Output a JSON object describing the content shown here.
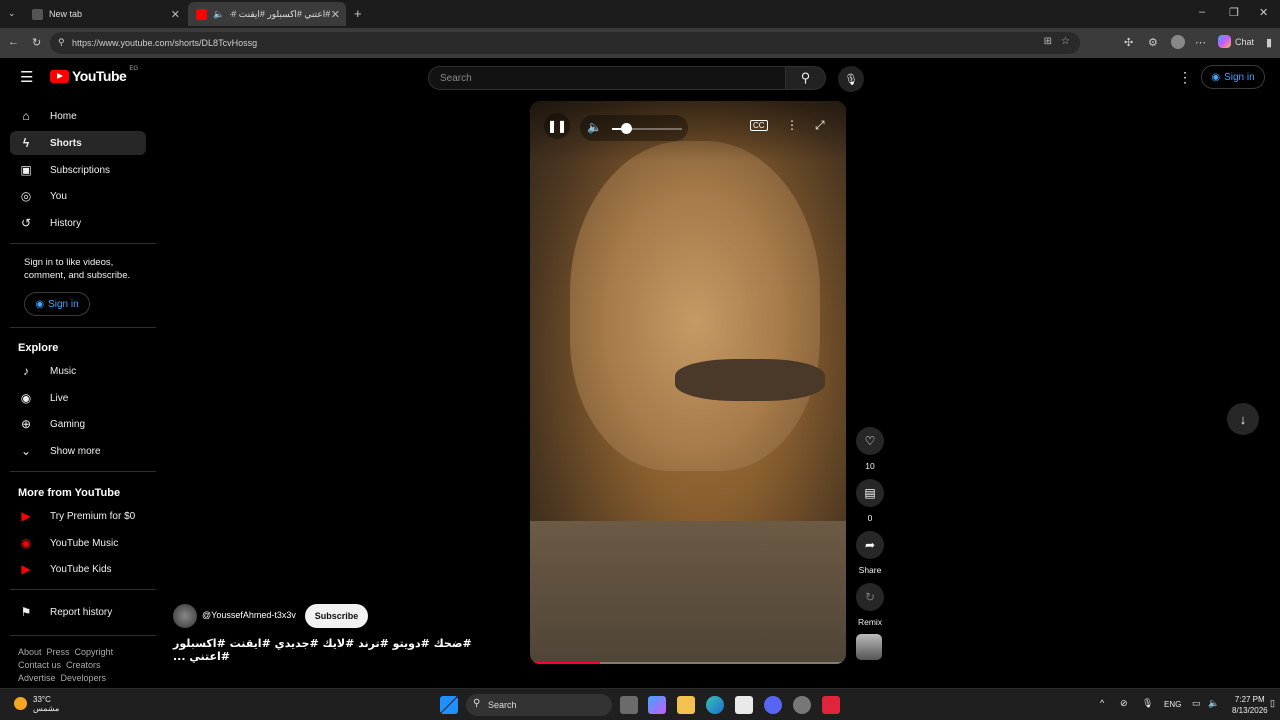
{
  "browser": {
    "tabs": [
      {
        "label": "New tab",
        "active": false
      },
      {
        "label": "#اعتني #اكسبلور #ايقنت #جديد",
        "active": true
      }
    ],
    "new_tab_symbol": "+",
    "url": "https://www.youtube.com/shorts/DL8TcvHossg",
    "toolbar_labels": {
      "chat": "Chat"
    }
  },
  "youtube": {
    "logo_text": "YouTube",
    "logo_country": "EG",
    "search_placeholder": "Search",
    "sign_in_label": "Sign in",
    "sidebar": {
      "main": [
        {
          "label": "Home",
          "icon": "home-icon",
          "active": false
        },
        {
          "label": "Shorts",
          "icon": "shorts-icon",
          "active": true
        },
        {
          "label": "Subscriptions",
          "icon": "subscriptions-icon",
          "active": false
        },
        {
          "label": "You",
          "icon": "you-icon",
          "active": false
        },
        {
          "label": "History",
          "icon": "history-icon",
          "active": false
        }
      ],
      "signin_message": "Sign in to like videos, comment, and subscribe.",
      "signin_button": "Sign in",
      "explore_title": "Explore",
      "explore": [
        {
          "label": "Music",
          "icon": "music-icon"
        },
        {
          "label": "Live",
          "icon": "live-icon"
        },
        {
          "label": "Gaming",
          "icon": "gaming-icon"
        },
        {
          "label": "Show more",
          "icon": "chevron-down-icon"
        }
      ],
      "more_title": "More from YouTube",
      "more": [
        {
          "label": "Try Premium for $0",
          "icon": "youtube-premium-icon"
        },
        {
          "label": "YouTube Music",
          "icon": "youtube-music-icon"
        },
        {
          "label": "YouTube Kids",
          "icon": "youtube-kids-icon"
        }
      ],
      "report_history": "Report history",
      "footer_row1": [
        "About",
        "Press",
        "Copyright"
      ],
      "footer_row2": [
        "Contact us",
        "Creators"
      ],
      "footer_row3": [
        "Advertise",
        "Developers"
      ]
    },
    "short": {
      "channel": "@YoussefAhmed-t3x3v",
      "subscribe_label": "Subscribe",
      "caption": "#ضحك #دويتو #ترند #لايك #جديدي #ايقنت #اكسبلور #اعتني ...",
      "volume_level": 0.2,
      "progress": 0.22,
      "actions": [
        {
          "name": "like",
          "icon": "heart-icon",
          "label": "10"
        },
        {
          "name": "comments",
          "icon": "comment-icon",
          "label": "0"
        },
        {
          "name": "share",
          "icon": "share-icon",
          "label": "Share"
        },
        {
          "name": "remix",
          "icon": "remix-icon",
          "label": "Remix"
        }
      ]
    }
  },
  "taskbar": {
    "weather_temp": "33°C",
    "weather_desc": "مشمس",
    "search_label": "Search",
    "lang": "ENG",
    "time": "7:27 PM",
    "date": "8/13/2026"
  },
  "colors": {
    "youtube_red": "#ff0000",
    "link_blue": "#3ea6ff",
    "progress_red": "#ff0033"
  }
}
